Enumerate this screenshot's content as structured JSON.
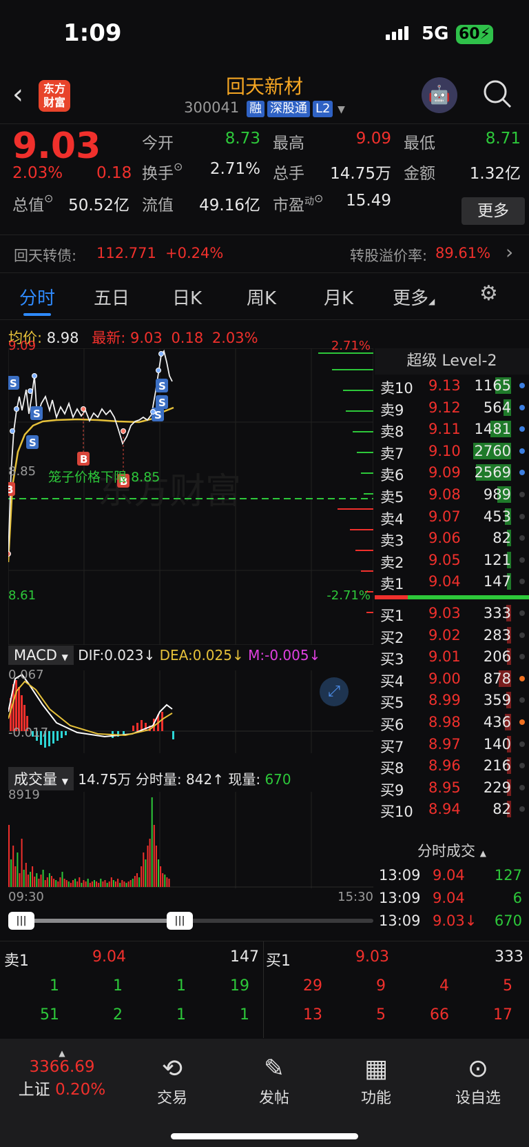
{
  "status": {
    "time": "1:09",
    "network": "5G",
    "battery": "60"
  },
  "header": {
    "name": "回天新材",
    "code": "300041",
    "tags": [
      "融",
      "深股通",
      "L2"
    ],
    "logo": "东方财富"
  },
  "quote": {
    "price": "9.03",
    "change_pct": "2.03%",
    "change": "0.18",
    "fields": [
      {
        "label": "今开",
        "value": "8.73",
        "color": "green"
      },
      {
        "label": "最高",
        "value": "9.09",
        "color": "red"
      },
      {
        "label": "最低",
        "value": "8.71",
        "color": "green"
      },
      {
        "label": "换手",
        "value": "2.71%",
        "color": "white"
      },
      {
        "label": "总手",
        "value": "14.75万",
        "color": "white"
      },
      {
        "label": "金额",
        "value": "1.32亿",
        "color": "white"
      },
      {
        "label": "总值",
        "value": "50.52亿",
        "color": "white"
      },
      {
        "label": "流值",
        "value": "49.16亿",
        "color": "white"
      },
      {
        "label": "市盈",
        "label_sup": "动",
        "value": "15.49",
        "color": "white"
      }
    ],
    "more": "更多"
  },
  "bond": {
    "name": "回天转债:",
    "price": "112.771",
    "pct": "+0.24%",
    "premium_label": "转股溢价率:",
    "premium": "89.61%"
  },
  "tabs": [
    "分时",
    "五日",
    "日K",
    "周K",
    "月K",
    "更多"
  ],
  "avg": {
    "avg_label": "均价:",
    "avg": "8.98",
    "last_label": "最新:",
    "last": "9.03",
    "chg": "0.18",
    "pct": "2.03%"
  },
  "chart": {
    "ymax": "9.09",
    "ymin": "8.61",
    "pmax": "2.71%",
    "pmin": "-2.71%",
    "mid": "8.85",
    "cage_label": "笼子价格下限",
    "cage": "8.85",
    "t_start": "09:30",
    "t_end": "15:30",
    "watermark": "东方财富"
  },
  "macd": {
    "label": "MACD",
    "dif": "DIF:0.023",
    "dea": "DEA:0.025",
    "m": "M:-0.005",
    "top": "0.067",
    "bottom": "-0.017"
  },
  "volume": {
    "label": "成交量",
    "total": "14.75万",
    "fen_label": "分时量:",
    "fen": "842",
    "cur_label": "现量:",
    "cur": "670",
    "max": "8919"
  },
  "level2": {
    "title": "超级 Level-2",
    "sells": [
      [
        "卖10",
        "9.13",
        "1165"
      ],
      [
        "卖9",
        "9.12",
        "564"
      ],
      [
        "卖8",
        "9.11",
        "1481"
      ],
      [
        "卖7",
        "9.10",
        "2760"
      ],
      [
        "卖6",
        "9.09",
        "2569"
      ],
      [
        "卖5",
        "9.08",
        "989"
      ],
      [
        "卖4",
        "9.07",
        "453"
      ],
      [
        "卖3",
        "9.06",
        "82"
      ],
      [
        "卖2",
        "9.05",
        "121"
      ],
      [
        "卖1",
        "9.04",
        "147"
      ]
    ],
    "buys": [
      [
        "买1",
        "9.03",
        "333"
      ],
      [
        "买2",
        "9.02",
        "283"
      ],
      [
        "买3",
        "9.01",
        "206"
      ],
      [
        "买4",
        "9.00",
        "878"
      ],
      [
        "买5",
        "8.99",
        "359"
      ],
      [
        "买6",
        "8.98",
        "436"
      ],
      [
        "买7",
        "8.97",
        "140"
      ],
      [
        "买8",
        "8.96",
        "216"
      ],
      [
        "买9",
        "8.95",
        "229"
      ],
      [
        "买10",
        "8.94",
        "82"
      ]
    ]
  },
  "trades": {
    "title": "分时成交",
    "rows": [
      [
        "13:09",
        "9.04",
        "127"
      ],
      [
        "13:09",
        "9.04",
        "6"
      ],
      [
        "13:09",
        "9.03↓",
        "670"
      ]
    ]
  },
  "bottombook": {
    "sell_label": "卖1",
    "sell_price": "9.04",
    "sell_vol": "147",
    "buy_label": "买1",
    "buy_price": "9.03",
    "buy_vol": "333",
    "sell_q1": [
      "1",
      "1",
      "1",
      "19"
    ],
    "sell_q2": [
      "51",
      "2",
      "1",
      "1"
    ],
    "buy_q1": [
      "29",
      "9",
      "4",
      "5"
    ],
    "buy_q2": [
      "13",
      "5",
      "66",
      "17"
    ]
  },
  "nav": {
    "index_value": "3366.69",
    "index_name": "上证",
    "index_pct": "0.20%",
    "items": [
      "交易",
      "发帖",
      "功能",
      "设自选"
    ]
  }
}
